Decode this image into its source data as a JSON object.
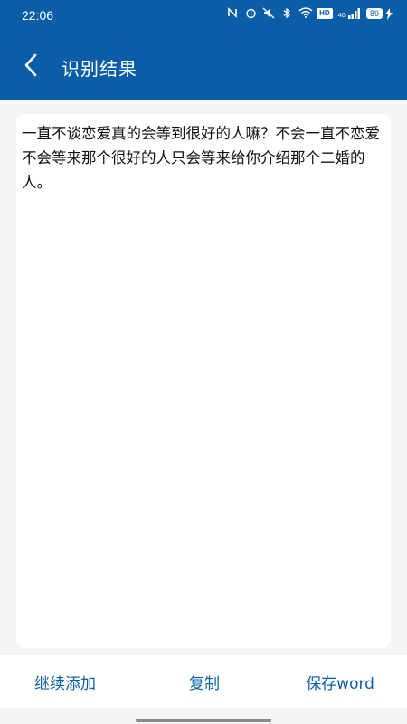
{
  "status_bar": {
    "time": "22:06",
    "icons": [
      "nfc-icon",
      "alarm-icon",
      "mute-icon",
      "bluetooth-icon",
      "wifi-icon",
      "hd-icon",
      "signal-icon",
      "battery-icon",
      "charging-icon"
    ],
    "hd_label": "HD",
    "signal_label": "4G",
    "battery_level": "89"
  },
  "app_bar": {
    "title": "识别结果"
  },
  "content": {
    "recognized_text": "一直不谈恋爱真的会等到很好的人嘛？不会一直不恋爱不会等来那个很好的人只会等来给你介绍那个二婚的人。"
  },
  "bottom_bar": {
    "continue_label": "继续添加",
    "copy_label": "复制",
    "save_word_label": "保存word"
  },
  "colors": {
    "primary": "#0a5ea8",
    "background": "#f5f5f5",
    "card": "#ffffff"
  }
}
